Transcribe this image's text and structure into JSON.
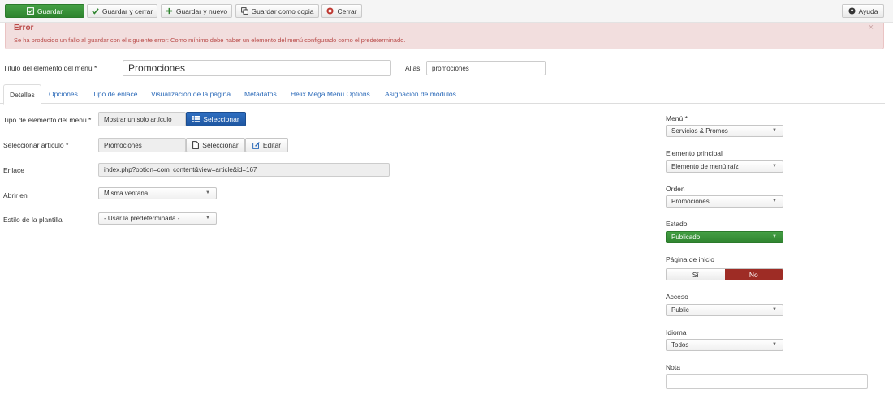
{
  "toolbar": {
    "save": "Guardar",
    "save_close": "Guardar y cerrar",
    "save_new": "Guardar y nuevo",
    "save_copy": "Guardar como copia",
    "close": "Cerrar",
    "help": "Ayuda"
  },
  "alert": {
    "title": "Error",
    "message": "Se ha producido un fallo al guardar con el siguiente error: Como mínimo debe haber un elemento del menú configurado como el predeterminado.",
    "close": "×"
  },
  "title_row": {
    "title_label": "Título del elemento del menú *",
    "title_value": "Promociones",
    "alias_label": "Alias",
    "alias_value": "promociones"
  },
  "tabs": [
    "Detalles",
    "Opciones",
    "Tipo de enlace",
    "Visualización de la página",
    "Metadatos",
    "Helix Mega Menu Options",
    "Asignación de módulos"
  ],
  "details": {
    "type_label": "Tipo de elemento del menú *",
    "type_value": "Mostrar un solo artículo",
    "type_button": "Seleccionar",
    "article_label": "Seleccionar artículo *",
    "article_value": "Promociones",
    "article_select": "Seleccionar",
    "article_edit": "Editar",
    "link_label": "Enlace",
    "link_value": "index.php?option=com_content&view=article&id=167",
    "open_label": "Abrir en",
    "open_value": "Misma ventana",
    "style_label": "Estilo de la plantilla",
    "style_value": "- Usar la predeterminada -"
  },
  "sidebar": {
    "menu_label": "Menú *",
    "menu_value": "Servicios & Promos",
    "parent_label": "Elemento principal",
    "parent_value": "Elemento de menú raíz",
    "order_label": "Orden",
    "order_value": "Promociones",
    "status_label": "Estado",
    "status_value": "Publicado",
    "home_label": "Página de inicio",
    "home_yes": "Sí",
    "home_no": "No",
    "access_label": "Acceso",
    "access_value": "Public",
    "language_label": "Idioma",
    "language_value": "Todos",
    "note_label": "Nota",
    "note_value": ""
  },
  "colors": {
    "save_green": "#2f842f",
    "error_bg": "#f2dede",
    "error_text": "#b94a48",
    "select_blue": "#1e56a0",
    "no_red": "#9e2c25",
    "link_blue": "#2a69b8"
  },
  "icons": {
    "save": "edit-check-icon",
    "save_close": "checkmark-icon",
    "save_new": "plus-icon",
    "save_copy": "copy-icon",
    "close": "cancel-circle-icon",
    "help": "question-circle-icon",
    "select": "list-icon",
    "article_select": "file-icon",
    "article_edit": "edit-icon",
    "dropdown": "caret-down-icon"
  }
}
